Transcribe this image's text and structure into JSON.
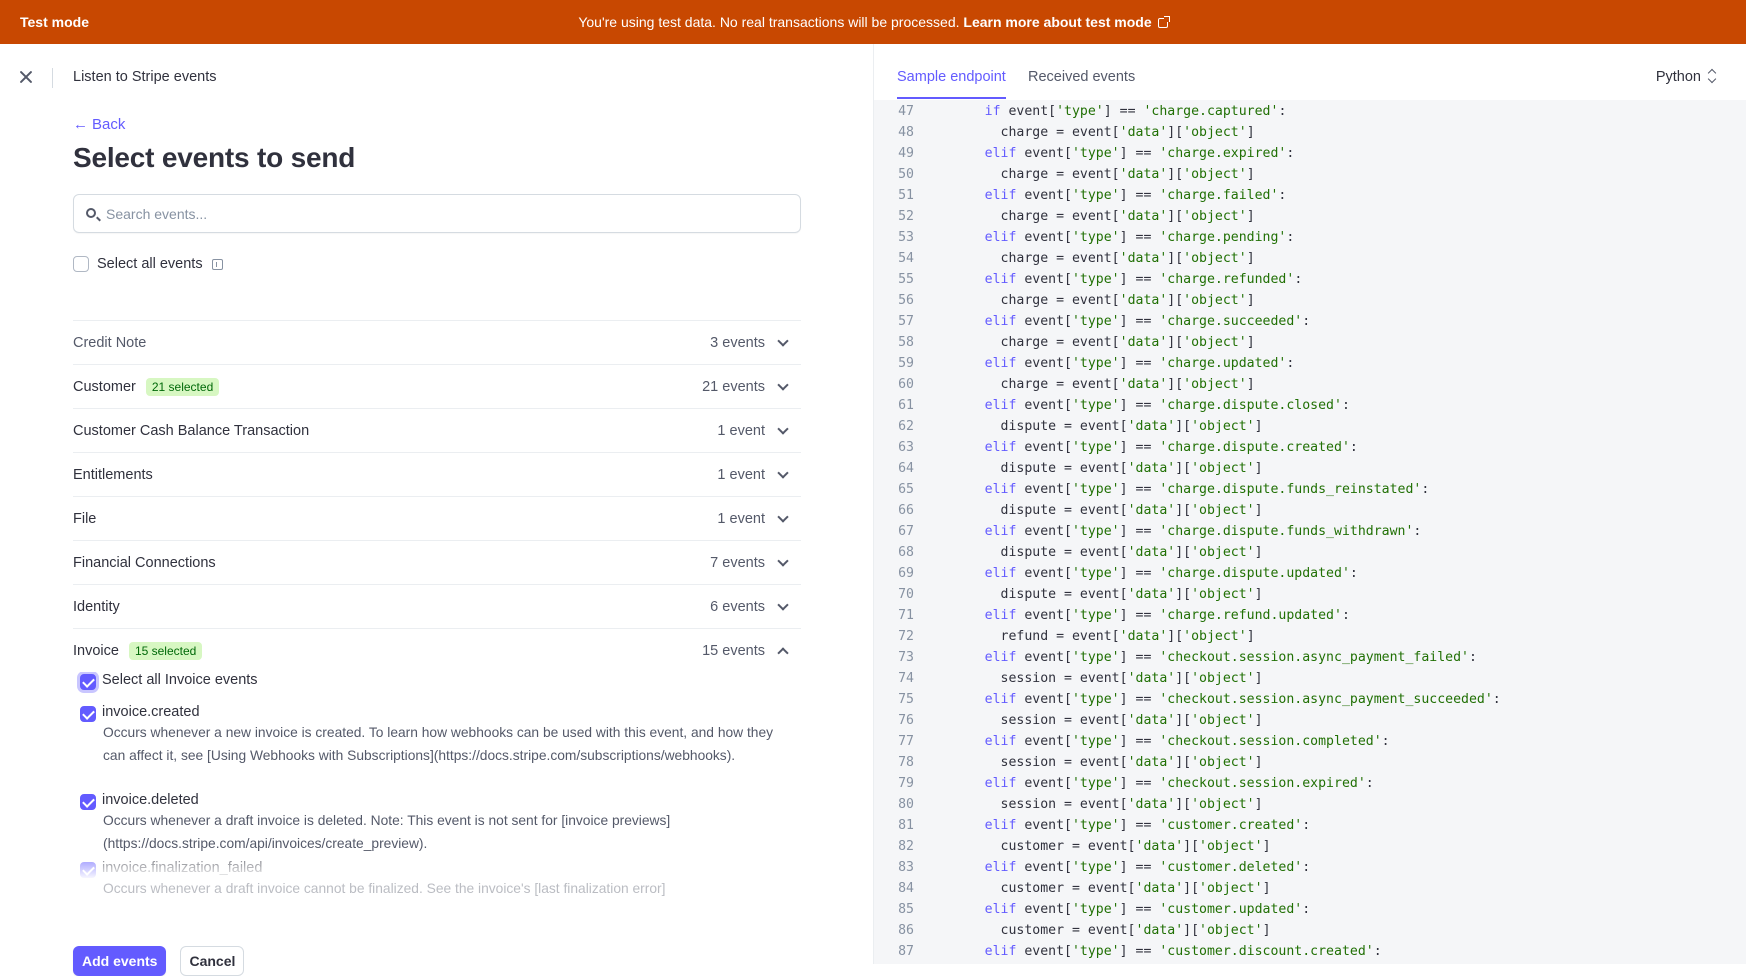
{
  "banner": {
    "mode_label": "Test mode",
    "message": "You're using test data. No real transactions will be processed.",
    "link_label": "Learn more about test mode"
  },
  "header": {
    "title": "Listen to Stripe events"
  },
  "left": {
    "back_label": "Back",
    "page_title": "Select events to send",
    "search_placeholder": "Search events...",
    "select_all_label": "Select all events",
    "groups": [
      {
        "name": "Credit Note",
        "count": "3 events",
        "badge": "",
        "muted": true,
        "expanded": false
      },
      {
        "name": "Customer",
        "count": "21 events",
        "badge": "21 selected",
        "expanded": false
      },
      {
        "name": "Customer Cash Balance Transaction",
        "count": "1 event",
        "badge": "",
        "expanded": false
      },
      {
        "name": "Entitlements",
        "count": "1 event",
        "badge": "",
        "expanded": false
      },
      {
        "name": "File",
        "count": "1 event",
        "badge": "",
        "expanded": false
      },
      {
        "name": "Financial Connections",
        "count": "7 events",
        "badge": "",
        "expanded": false
      },
      {
        "name": "Identity",
        "count": "6 events",
        "badge": "",
        "expanded": false
      },
      {
        "name": "Invoice",
        "count": "15 events",
        "badge": "15 selected",
        "expanded": true
      }
    ],
    "invoice_select_all": "Select all Invoice events",
    "invoice_events": [
      {
        "name": "invoice.created",
        "description": "Occurs whenever a new invoice is created. To learn how webhooks can be used with this event, and how they can affect it, see [Using Webhooks with Subscriptions](https://docs.stripe.com/subscriptions/webhooks)."
      },
      {
        "name": "invoice.deleted",
        "description": "Occurs whenever a draft invoice is deleted. Note: This event is not sent for [invoice previews](https://docs.stripe.com/api/invoices/create_preview)."
      },
      {
        "name": "invoice.finalization_failed",
        "description": "Occurs whenever a draft invoice cannot be finalized. See the invoice's [last finalization error]"
      }
    ],
    "add_button": "Add events",
    "cancel_button": "Cancel"
  },
  "right": {
    "tabs": [
      "Sample endpoint",
      "Received events"
    ],
    "language": "Python",
    "code_lines": [
      {
        "n": "47",
        "t": "if",
        "etype": "charge.captured",
        "var": "charge"
      },
      {
        "n": "49",
        "t": "elif",
        "etype": "charge.expired",
        "var": "charge"
      },
      {
        "n": "51",
        "t": "elif",
        "etype": "charge.failed",
        "var": "charge"
      },
      {
        "n": "53",
        "t": "elif",
        "etype": "charge.pending",
        "var": "charge"
      },
      {
        "n": "55",
        "t": "elif",
        "etype": "charge.refunded",
        "var": "charge"
      },
      {
        "n": "57",
        "t": "elif",
        "etype": "charge.succeeded",
        "var": "charge"
      },
      {
        "n": "59",
        "t": "elif",
        "etype": "charge.updated",
        "var": "charge"
      },
      {
        "n": "61",
        "t": "elif",
        "etype": "charge.dispute.closed",
        "var": "dispute"
      },
      {
        "n": "63",
        "t": "elif",
        "etype": "charge.dispute.created",
        "var": "dispute"
      },
      {
        "n": "65",
        "t": "elif",
        "etype": "charge.dispute.funds_reinstated",
        "var": "dispute"
      },
      {
        "n": "67",
        "t": "elif",
        "etype": "charge.dispute.funds_withdrawn",
        "var": "dispute"
      },
      {
        "n": "69",
        "t": "elif",
        "etype": "charge.dispute.updated",
        "var": "dispute"
      },
      {
        "n": "71",
        "t": "elif",
        "etype": "charge.refund.updated",
        "var": "refund"
      },
      {
        "n": "73",
        "t": "elif",
        "etype": "checkout.session.async_payment_failed",
        "var": "session"
      },
      {
        "n": "75",
        "t": "elif",
        "etype": "checkout.session.async_payment_succeeded",
        "var": "session"
      },
      {
        "n": "77",
        "t": "elif",
        "etype": "checkout.session.completed",
        "var": "session"
      },
      {
        "n": "79",
        "t": "elif",
        "etype": "checkout.session.expired",
        "var": "session"
      },
      {
        "n": "81",
        "t": "elif",
        "etype": "customer.created",
        "var": "customer"
      },
      {
        "n": "83",
        "t": "elif",
        "etype": "customer.deleted",
        "var": "customer"
      },
      {
        "n": "85",
        "t": "elif",
        "etype": "customer.updated",
        "var": "customer"
      },
      {
        "n": "87",
        "t": "elif",
        "etype": "customer.discount.created",
        "var": ""
      }
    ]
  },
  "colors": {
    "banner": "#c84801",
    "accent": "#635bff",
    "badge_bg": "#d7f7c2",
    "badge_text": "#006908",
    "code_string": "#217005"
  }
}
